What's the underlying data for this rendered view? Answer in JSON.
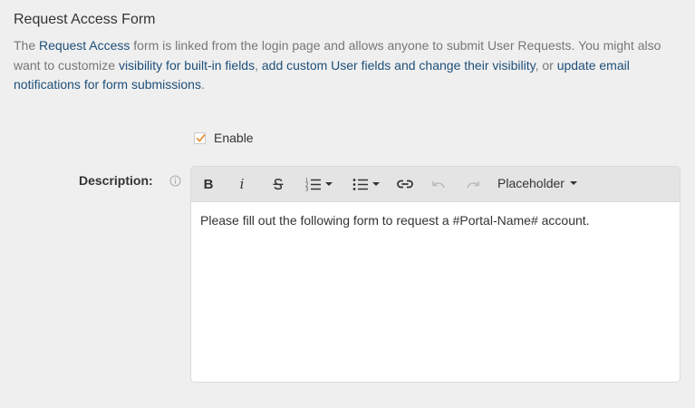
{
  "page": {
    "title": "Request Access Form"
  },
  "intro": {
    "t1": "The ",
    "link_request_access": "Request Access",
    "t2": " form is linked from the login page and allows anyone to submit User Requests. You might also want to customize ",
    "link_visibility": "visibility for built-in fields",
    "t3": ", ",
    "link_custom_fields": "add custom User fields and change their visibility",
    "t4": ", or ",
    "link_notifications": "update email notifications for form submissions",
    "t5": "."
  },
  "enable": {
    "label": "Enable",
    "checked": true,
    "check_color": "#e8923a"
  },
  "description": {
    "label": "Description:",
    "info_icon": "info-icon"
  },
  "editor": {
    "toolbar": {
      "bold": "B",
      "italic": "i",
      "strikethrough_icon": "strikethrough-icon",
      "ordered_list_icon": "ordered-list-icon",
      "bullet_list_icon": "bullet-list-icon",
      "link_icon": "link-icon",
      "undo_icon": "undo-icon",
      "redo_icon": "redo-icon",
      "placeholder_label": "Placeholder"
    },
    "content": "Please fill out the following form to request a #Portal-Name# account."
  }
}
